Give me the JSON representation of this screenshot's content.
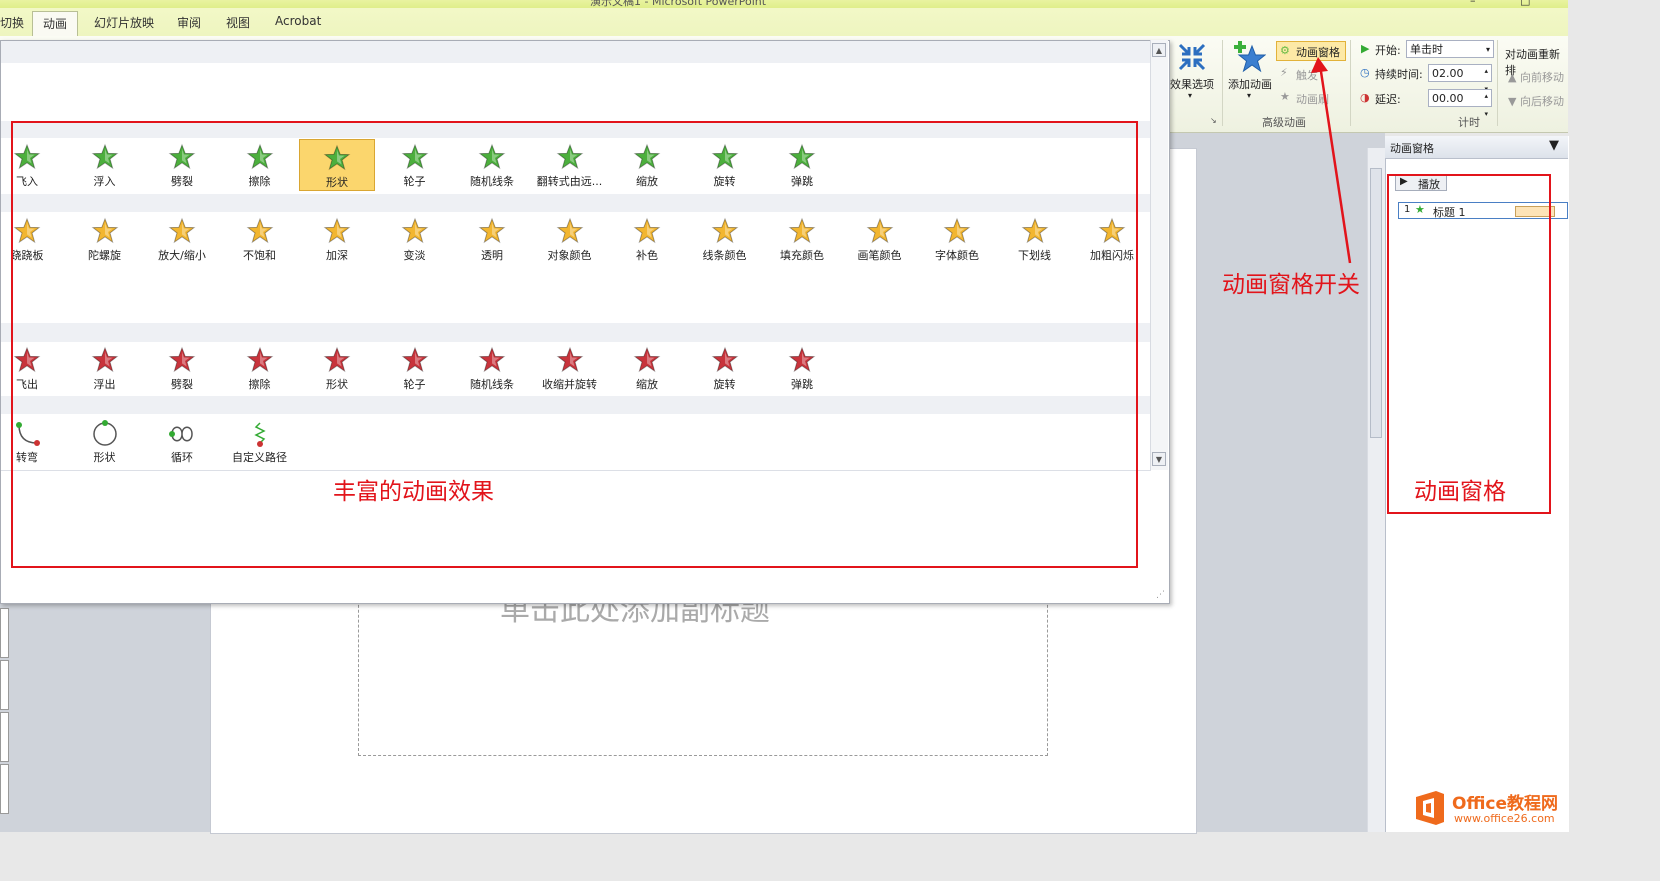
{
  "window": {
    "title": "演示文稿1 - Microsoft PowerPoint"
  },
  "tabs": [
    {
      "label": "切换"
    },
    {
      "label": "动画"
    },
    {
      "label": "幻灯片放映"
    },
    {
      "label": "审阅"
    },
    {
      "label": "视图"
    },
    {
      "label": "Acrobat"
    }
  ],
  "ribbon": {
    "effect_options": "效果选项",
    "add_animation": "添加动画",
    "animation_pane_btn": "动画窗格",
    "trigger": "触发",
    "animation_painter": "动画刷",
    "advanced_group": "高级动画",
    "start_label": "开始:",
    "start_value": "单击时",
    "duration_label": "持续时间:",
    "duration_value": "02.00",
    "delay_label": "延迟:",
    "delay_value": "00.00",
    "timing_group": "计时",
    "reorder_label": "对动画重新排",
    "move_earlier": "向前移动",
    "move_later": "向后移动"
  },
  "slide": {
    "subtitle_placeholder": "单击此处添加副标题"
  },
  "pane": {
    "title": "动画窗格",
    "play": "播放",
    "item": {
      "index": "1",
      "name": "标题 1"
    }
  },
  "gallery": {
    "entrance": [
      "飞入",
      "浮入",
      "劈裂",
      "擦除",
      "形状",
      "轮子",
      "随机线条",
      "翻转式由远...",
      "缩放",
      "旋转",
      "弹跳"
    ],
    "emphasis": [
      "跷跷板",
      "陀螺旋",
      "放大/缩小",
      "不饱和",
      "加深",
      "变淡",
      "透明",
      "对象颜色",
      "补色",
      "线条颜色",
      "填充颜色",
      "画笔颜色",
      "字体颜色",
      "下划线",
      "加粗闪烁"
    ],
    "exit": [
      "飞出",
      "浮出",
      "劈裂",
      "擦除",
      "形状",
      "轮子",
      "随机线条",
      "收缩并旋转",
      "缩放",
      "旋转",
      "弹跳"
    ],
    "paths": [
      "转弯",
      "形状",
      "循环",
      "自定义路径"
    ],
    "selected": "形状"
  },
  "annotations": {
    "gallery_note": "丰富的动画效果",
    "toggle_note": "动画窗格开关",
    "pane_note": "动画窗格"
  },
  "logo": {
    "brand": "Office教程网",
    "url": "www.office26.com"
  },
  "colors": {
    "entrance_star": "#4caf3d",
    "emphasis_star": "#f2b630",
    "exit_star": "#c8343c",
    "annotation": "#e2141b",
    "logo_orange": "#ef6a1c"
  }
}
